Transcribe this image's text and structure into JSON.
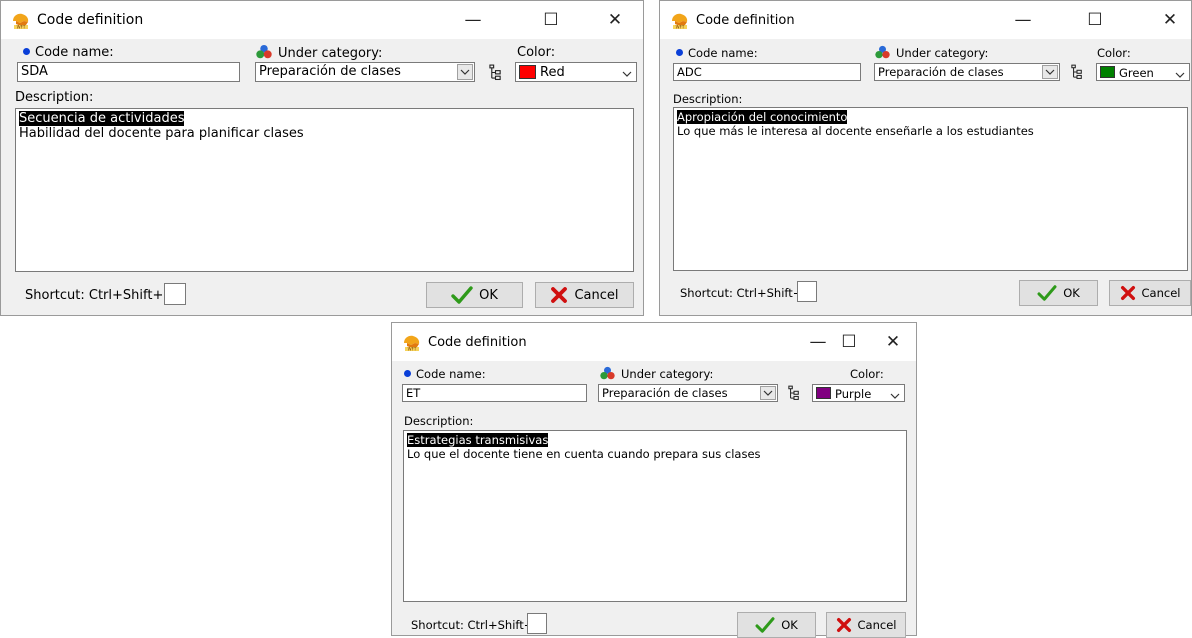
{
  "dialogs": [
    {
      "title": "Code definition",
      "code_name_label": "Code name:",
      "code_name_value": "SDA",
      "under_category_label": "Under category:",
      "under_category_value": "Preparación de clases",
      "color_label": "Color:",
      "color_name": "Red",
      "color_hex": "#ff0000",
      "description_label": "Description:",
      "description_line1": "Secuencia de actividades",
      "description_line2": "Habilidad del docente para planificar clases",
      "shortcut_label": "Shortcut: Ctrl+Shift+",
      "shortcut_value": "",
      "ok_label": "OK",
      "cancel_label": "Cancel"
    },
    {
      "title": "Code definition",
      "code_name_label": "Code name:",
      "code_name_value": "ADC",
      "under_category_label": "Under category:",
      "under_category_value": "Preparación de clases",
      "color_label": "Color:",
      "color_name": "Green",
      "color_hex": "#008000",
      "description_label": "Description:",
      "description_line1": "Apropiación del conocimiento",
      "description_line2": "Lo que más le interesa al docente enseñarle a los estudiantes",
      "shortcut_label": "Shortcut: Ctrl+Shift+",
      "shortcut_value": "",
      "ok_label": "OK",
      "cancel_label": "Cancel"
    },
    {
      "title": "Code definition",
      "code_name_label": "Code name:",
      "code_name_value": "ET",
      "under_category_label": "Under category:",
      "under_category_value": "Preparación de clases",
      "color_label": "Color:",
      "color_name": "Purple",
      "color_hex": "#800080",
      "description_label": "Description:",
      "description_line1": "Estrategias transmisivas",
      "description_line2": "Lo que el docente tiene en cuenta cuando prepara sus clases",
      "shortcut_label": "Shortcut: Ctrl+Shift+",
      "shortcut_value": "",
      "ok_label": "OK",
      "cancel_label": "Cancel"
    }
  ],
  "window_controls": {
    "minimize_glyph": "—",
    "maximize_glyph": "☐",
    "close_glyph": "✕"
  },
  "icons": {
    "app": "weft-qda-app-icon",
    "category": "category-balls-icon",
    "tree": "tree-browse-icon",
    "ok": "checkmark-icon",
    "cancel": "x-icon"
  },
  "accent_colors": {
    "bullet": "#0a3fd8",
    "ok_check": "#2e9a1a",
    "cancel_x": "#d01010",
    "selection_bg": "#000000"
  }
}
